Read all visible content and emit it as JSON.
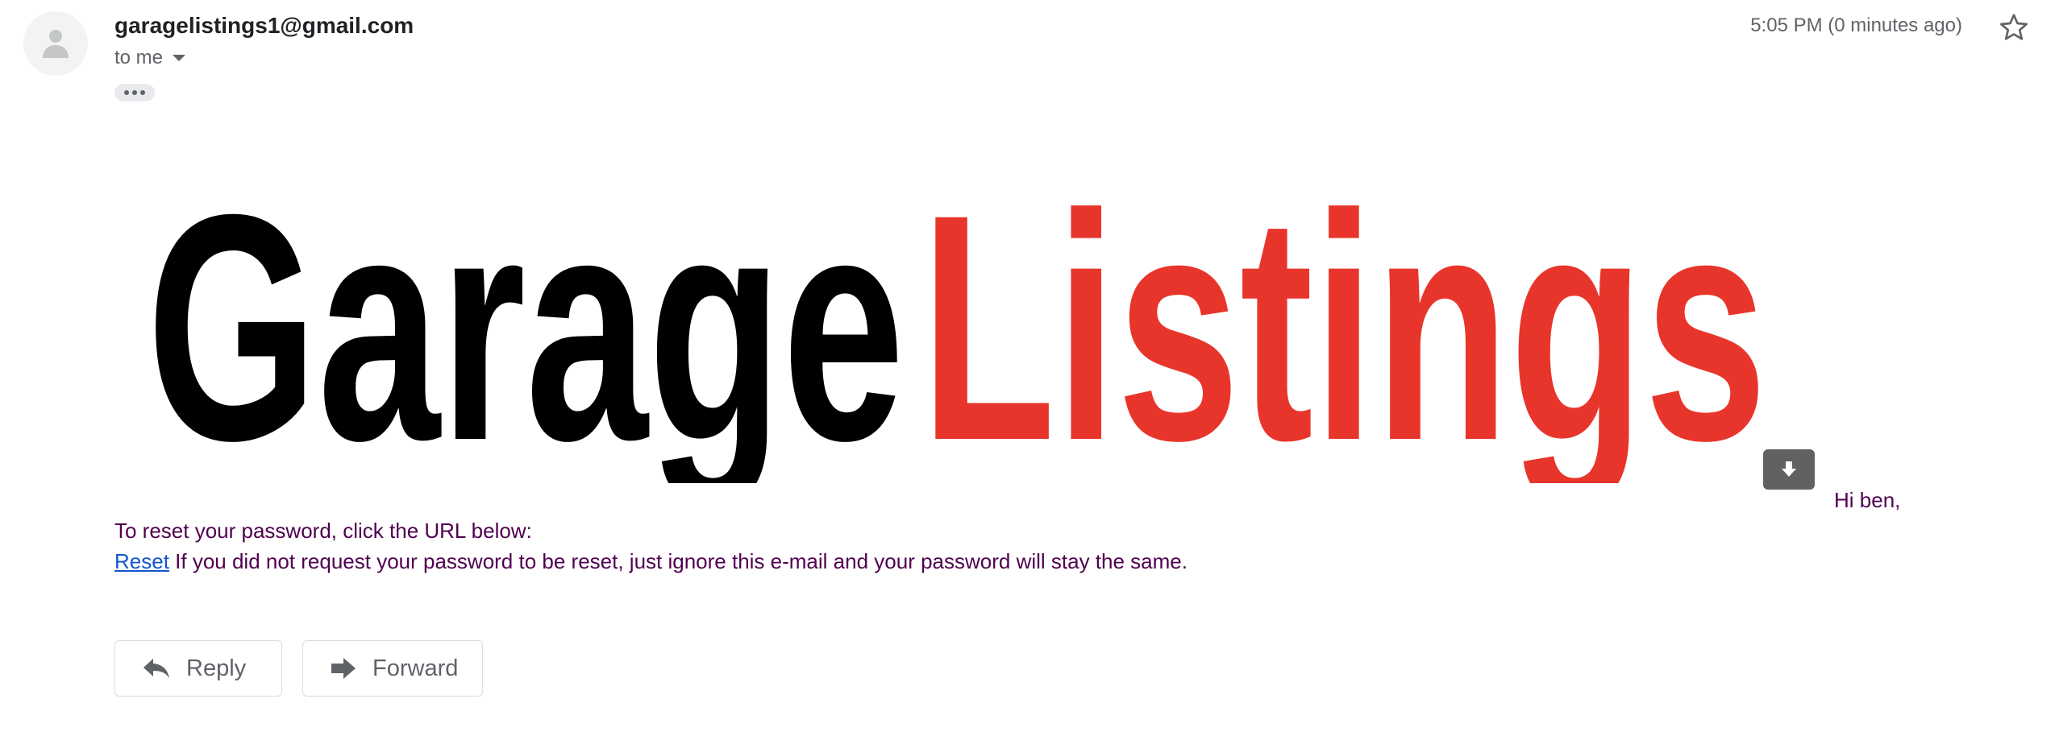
{
  "message": {
    "sender": "garagelistings1@gmail.com",
    "recipient_label": "to me",
    "timestamp": "5:05 PM (0 minutes ago)",
    "ellipsis_label": "•••"
  },
  "logo": {
    "word_dark": "Garage",
    "word_accent": "Listings",
    "color_dark": "#000000",
    "color_accent": "#e8352b"
  },
  "body": {
    "greeting": "Hi ben,",
    "line1": "To reset your password, click the URL below:",
    "link_text": "Reset",
    "line2_rest": " If you did not request your password to be reset, just ignore this e-mail and your password will stay the same."
  },
  "actions": {
    "reply_label": "Reply",
    "forward_label": "Forward"
  },
  "icons": {
    "avatar": "person-icon",
    "recipient_caret": "caret-down-icon",
    "star": "star-outline-icon",
    "download": "download-icon",
    "reply": "reply-arrow-icon",
    "forward": "forward-arrow-icon"
  },
  "colors": {
    "body_text": "#500050",
    "link": "#1155cc",
    "meta_text": "#5f6368",
    "download_bg": "#616161"
  }
}
